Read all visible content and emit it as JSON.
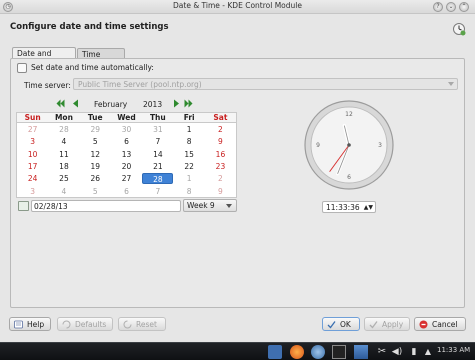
{
  "window": {
    "title": "Date & Time - KDE Control Module"
  },
  "header": {
    "title": "Configure date and time settings"
  },
  "tabs": [
    {
      "label": "Date and Time",
      "active": true
    },
    {
      "label": "Time Zone",
      "active": false
    }
  ],
  "auto": {
    "label": "Set date and time automatically:",
    "checked": false
  },
  "server": {
    "label": "Time server:",
    "value": "Public Time Server (pool.ntp.org)"
  },
  "calendar": {
    "month": "February",
    "year": "2013",
    "weekdays": [
      "Sun",
      "Mon",
      "Tue",
      "Wed",
      "Thu",
      "Fri",
      "Sat"
    ],
    "weeks": [
      [
        "27",
        "28",
        "29",
        "30",
        "31",
        "1",
        "2"
      ],
      [
        "3",
        "4",
        "5",
        "6",
        "7",
        "8",
        "9"
      ],
      [
        "10",
        "11",
        "12",
        "13",
        "14",
        "15",
        "16"
      ],
      [
        "17",
        "18",
        "19",
        "20",
        "21",
        "22",
        "23"
      ],
      [
        "24",
        "25",
        "26",
        "27",
        "28",
        "1",
        "2"
      ],
      [
        "3",
        "4",
        "5",
        "6",
        "7",
        "8",
        "9"
      ]
    ],
    "selected_day": "28",
    "date_field": "02/28/13",
    "week": "Week 9"
  },
  "clock": {
    "time": "11:33:36",
    "hour": 11,
    "minute": 33,
    "second": 36
  },
  "buttons": {
    "help": "Help",
    "defaults": "Defaults",
    "reset": "Reset",
    "ok": "OK",
    "apply": "Apply",
    "cancel": "Cancel"
  },
  "taskbar": {
    "clock": "11:33 AM"
  },
  "colors": {
    "accent": "#3f82d6",
    "sunday": "#c81e1e",
    "second_hand": "#d83030"
  }
}
